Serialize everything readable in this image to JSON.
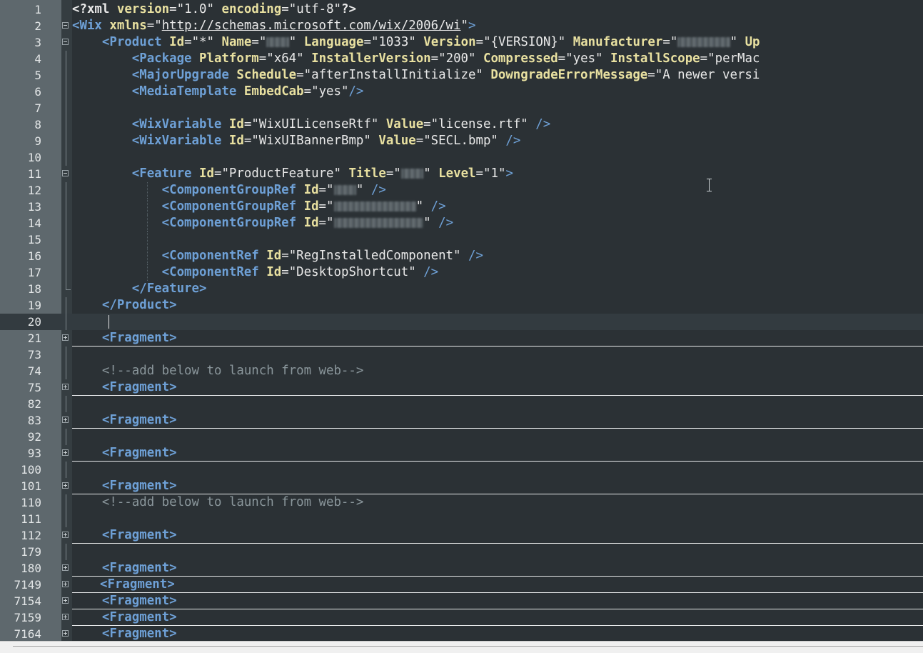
{
  "editor": {
    "line_numbers": [
      "1",
      "2",
      "3",
      "4",
      "5",
      "6",
      "7",
      "8",
      "9",
      "10",
      "11",
      "12",
      "13",
      "14",
      "15",
      "16",
      "17",
      "18",
      "19",
      "20",
      "21",
      "73",
      "74",
      "75",
      "82",
      "83",
      "92",
      "93",
      "100",
      "101",
      "110",
      "111",
      "112",
      "179",
      "180",
      "7149",
      "7154",
      "7159",
      "7164"
    ],
    "text": {
      "pi_open": "<?xml",
      "pi_version_attr": "version",
      "pi_version_val": "\"1.0\"",
      "pi_encoding_attr": "encoding",
      "pi_encoding_val": "\"utf-8\"",
      "pi_close": "?>",
      "wix_tag": "<Wix",
      "xmlns_attr": "xmlns",
      "xmlns_url": "http://schemas.microsoft.com/wix/2006/wi",
      "product_tag": "<Product",
      "id_attr": "Id",
      "star_val": "\"*\"",
      "name_attr": "Name",
      "language_attr": "Language",
      "language_val": "\"1033\"",
      "version_attr": "Version",
      "version_val": "\"{VERSION}\"",
      "manufacturer_attr": "Manufacturer",
      "up_attr": "Up",
      "package_tag": "<Package",
      "platform_attr": "Platform",
      "platform_val": "\"x64\"",
      "installerversion_attr": "InstallerVersion",
      "installerversion_val": "\"200\"",
      "compressed_attr": "Compressed",
      "compressed_val": "\"yes\"",
      "installscope_attr": "InstallScope",
      "installscope_val": "\"perMac",
      "majorupgrade_tag": "<MajorUpgrade",
      "schedule_attr": "Schedule",
      "schedule_val": "\"afterInstallInitialize\"",
      "downgrade_attr": "DowngradeErrorMessage",
      "downgrade_val": "\"A newer versi",
      "mediatemplate_tag": "<MediaTemplate",
      "embedcab_attr": "EmbedCab",
      "embedcab_val": "\"yes\"",
      "selfclose": "/>",
      "selfclose_sp": " />",
      "wixvariable_tag": "<WixVariable",
      "value_attr": "Value",
      "license_id_val": "\"WixUILicenseRtf\"",
      "license_val": "\"license.rtf\"",
      "banner_id_val": "\"WixUIBannerBmp\"",
      "banner_val": "\"SECL.bmp\"",
      "feature_tag": "<Feature",
      "feature_id_val": "\"ProductFeature\"",
      "title_attr": "Title",
      "level_attr": "Level",
      "level_val": "\"1\"",
      "gt": ">",
      "cgr_tag": "<ComponentGroupRef",
      "cref_tag": "<ComponentRef",
      "reginstalled_val": "\"RegInstalledComponent\"",
      "desktop_val": "\"DesktopShortcut\"",
      "feature_close": "</Feature>",
      "product_close": "</Product>",
      "fragment_tag": "<Fragment>",
      "comment_launch": "<!--add below to launch from web-->"
    }
  },
  "colors": {
    "background": "#2b3135",
    "gutter": "#5e686d",
    "tag": "#6ea0d6",
    "attribute": "#e8e0a0",
    "comment": "#8a969b"
  },
  "icons": {
    "fold_expanded": "fold-minus-icon",
    "fold_collapsed": "fold-plus-icon",
    "cursor": "ibeam-cursor-icon"
  }
}
